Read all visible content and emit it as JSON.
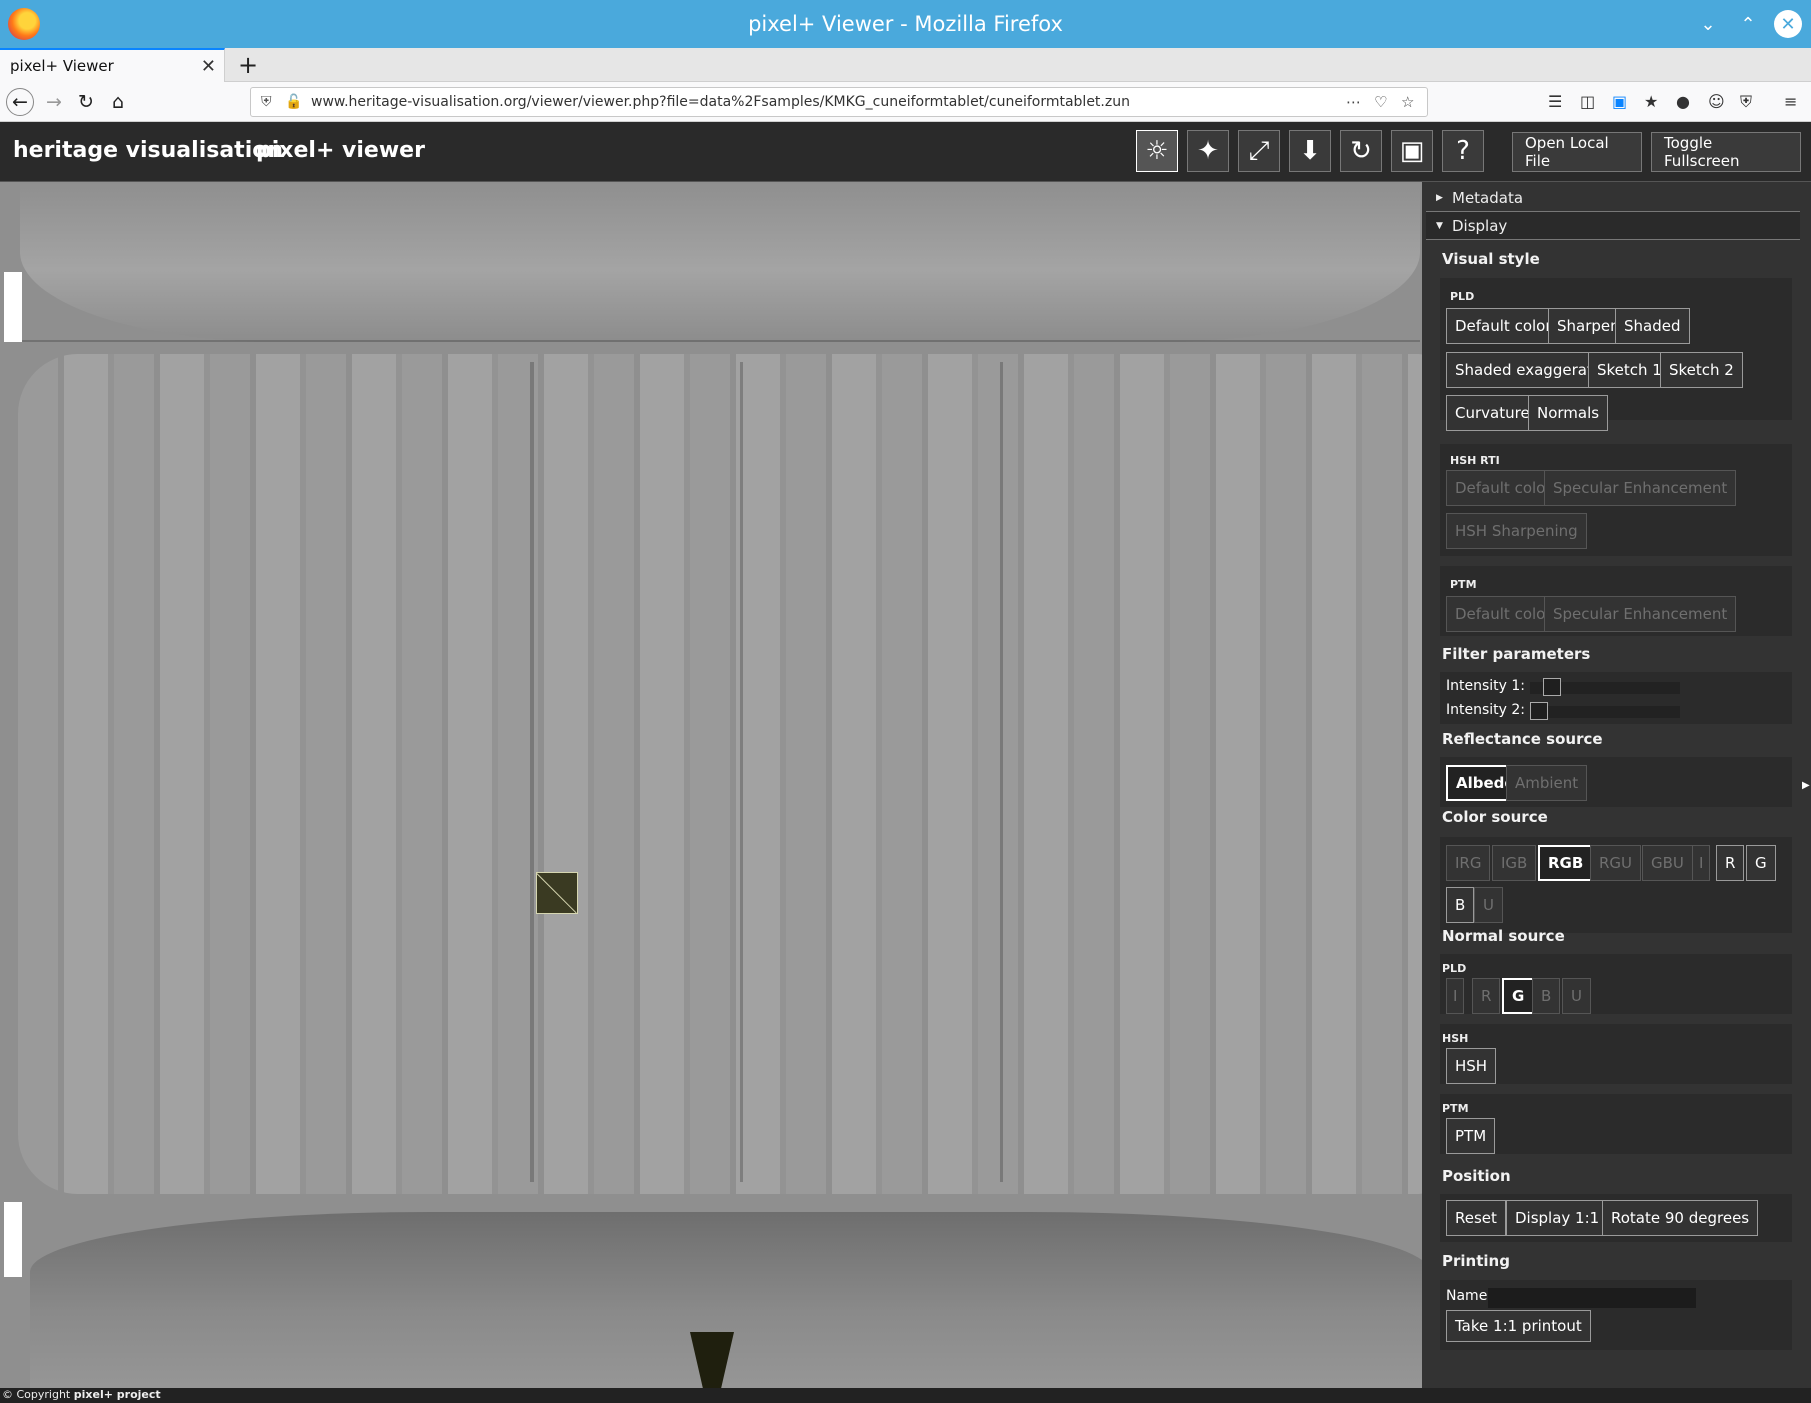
{
  "window": {
    "title": "pixel+ Viewer - Mozilla Firefox"
  },
  "tab": {
    "title": "pixel+ Viewer"
  },
  "url": "www.heritage-visualisation.org/viewer/viewer.php?file=data%2Fsamples/KMKG_cuneiformtablet/cuneiformtablet.zun",
  "header": {
    "brand": "heritage visualisation",
    "app_name": "pixel+ viewer",
    "open_local_file": "Open Local File",
    "toggle_fullscreen": "Toggle Fullscreen"
  },
  "sidebar": {
    "metadata": "Metadata",
    "display": "Display",
    "visual_style": {
      "title": "Visual style",
      "pld": {
        "label": "PLD",
        "buttons": [
          "Default color",
          "Sharpen",
          "Shaded",
          "Shaded exaggerated",
          "Sketch 1",
          "Sketch 2",
          "Curvature",
          "Normals"
        ]
      },
      "hsh_rti": {
        "label": "HSH RTI",
        "buttons": [
          "Default color",
          "Specular Enhancement",
          "HSH Sharpening"
        ]
      },
      "ptm": {
        "label": "PTM",
        "buttons": [
          "Default color",
          "Specular Enhancement"
        ]
      }
    },
    "filter_parameters": {
      "title": "Filter parameters",
      "intensity1": {
        "label": "Intensity 1:",
        "value": 0.1
      },
      "intensity2": {
        "label": "Intensity 2:",
        "value": 0.0
      }
    },
    "reflectance_source": {
      "title": "Reflectance source",
      "buttons": [
        "Albedo",
        "Ambient"
      ],
      "selected": "Albedo"
    },
    "color_source": {
      "title": "Color source",
      "buttons": [
        "IRG",
        "IGB",
        "RGB",
        "RGU",
        "GBU",
        "I",
        "R",
        "G",
        "B",
        "U"
      ],
      "selected": "RGB"
    },
    "normal_source": {
      "title": "Normal source",
      "pld": {
        "label": "PLD",
        "buttons": [
          "I",
          "R",
          "G",
          "B",
          "U"
        ],
        "selected": "G"
      },
      "hsh": {
        "label": "HSH",
        "button": "HSH"
      },
      "ptm": {
        "label": "PTM",
        "button": "PTM"
      }
    },
    "position": {
      "title": "Position",
      "buttons": [
        "Reset",
        "Display 1:1",
        "Rotate 90 degrees"
      ]
    },
    "printing": {
      "title": "Printing",
      "name_label": "Name:",
      "name_value": "",
      "button": "Take 1:1 printout"
    }
  },
  "footer": {
    "prefix": "© Copyright ",
    "project": "pixel+ project"
  }
}
